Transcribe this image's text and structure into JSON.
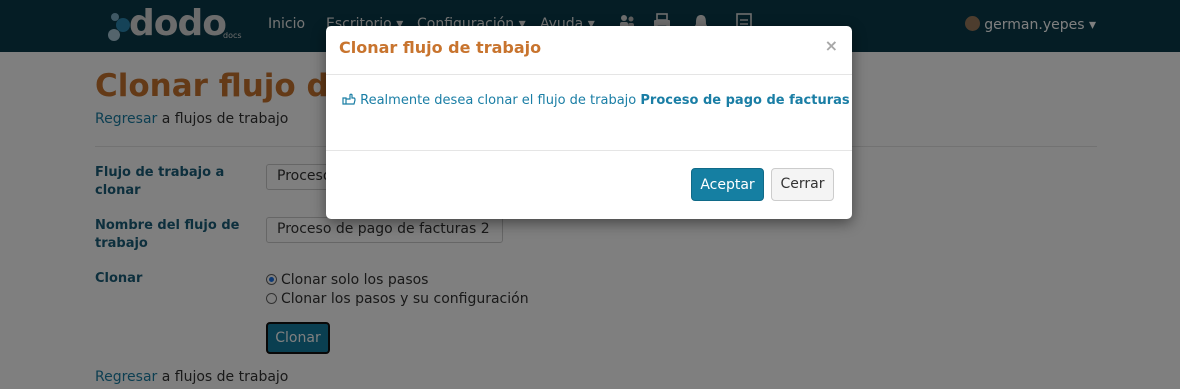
{
  "navbar": {
    "logo_text": "dodo",
    "logo_sub": "docs",
    "menu": [
      "Inicio",
      "Escritorio ▾",
      "Configuración ▾",
      "Ayuda ▾"
    ],
    "icons": [
      "users-icon",
      "printer-icon",
      "bell-icon",
      "document-icon"
    ],
    "user": "german.yepes ▾"
  },
  "page": {
    "title": "Clonar flujo de trabajo",
    "back_link_text": "Regresar",
    "back_link_suffix": " a flujos de trabajo",
    "fields": {
      "source_label": "Flujo de trabajo a clonar",
      "source_value": "Proceso de pago de facturas",
      "name_label": "Nombre del flujo de trabajo",
      "name_value": "Proceso de pago de facturas 2",
      "clone_label": "Clonar",
      "option_steps": "Clonar solo los pasos",
      "option_steps_config": "Clonar los pasos y su configuración",
      "selected_option": "Clonar solo los pasos"
    },
    "clone_button": "Clonar"
  },
  "modal": {
    "title": "Clonar flujo de trabajo",
    "close": "×",
    "message_prefix": "Realmente desea clonar el flujo de trabajo ",
    "workflow_name": "Proceso de pago de facturas",
    "accept_button": "Aceptar",
    "close_button": "Cerrar"
  }
}
